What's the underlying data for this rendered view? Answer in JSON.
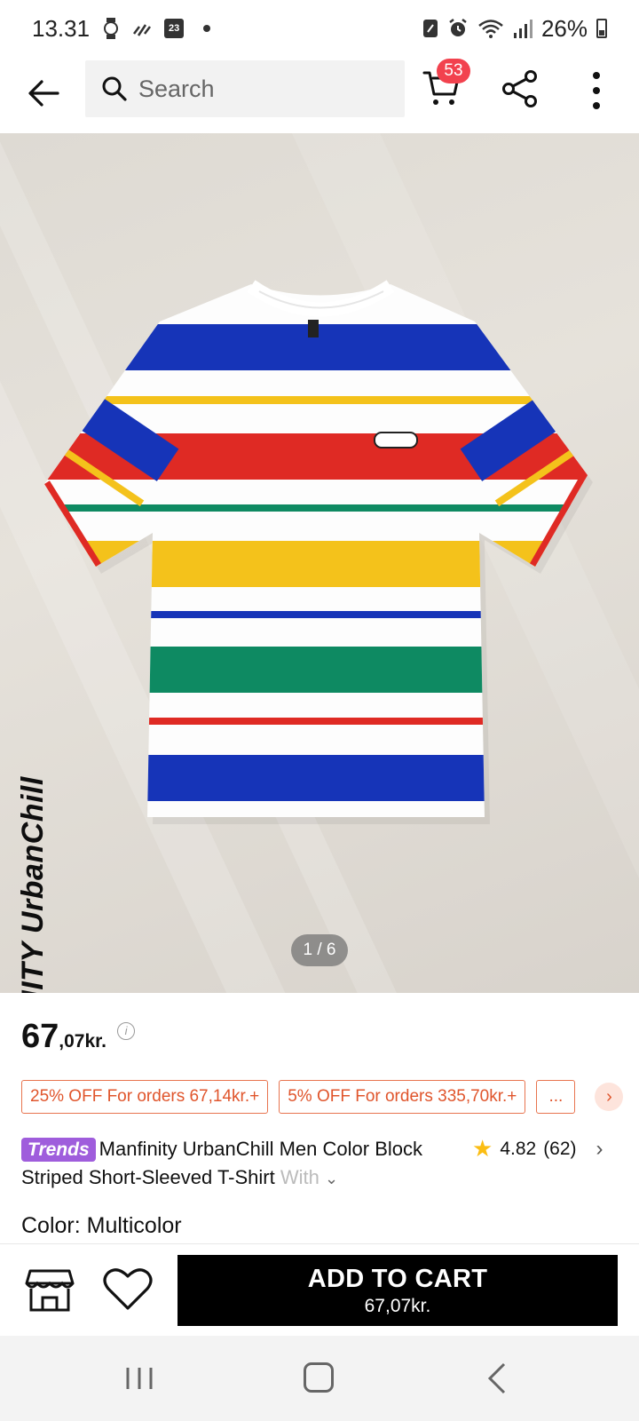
{
  "status_bar": {
    "time": "13.31",
    "calendar_day": "23",
    "battery": "26%",
    "icons": [
      "watch-icon",
      "data-saver-icon",
      "calendar-icon",
      "notification-dot",
      "nfc-icon",
      "alarm-icon",
      "wifi-icon",
      "signal-icon",
      "battery-icon"
    ]
  },
  "top_nav": {
    "search_placeholder": "Search",
    "cart_count": "53",
    "icons": [
      "back-arrow-icon",
      "search-icon",
      "cart-icon",
      "share-icon",
      "more-vertical-icon"
    ]
  },
  "hero": {
    "brand_text": "MANFINITY UrbanChill",
    "pager": "1 / 6"
  },
  "price": {
    "integer": "67",
    "decimal": ",07kr."
  },
  "coupons": [
    "25% OFF For orders 67,14kr.+",
    "5% OFF For orders 335,70kr.+",
    "..."
  ],
  "product": {
    "badge": "Trends",
    "title_main": "Manfinity UrbanChill Men Color Block Striped Short-Sleeved T-Shirt",
    "title_faded": " With"
  },
  "rating": {
    "value": "4.82",
    "count": "(62)"
  },
  "color": {
    "label": "Color: Multicolor"
  },
  "bottom_bar": {
    "add_to_cart_label": "ADD TO CART",
    "add_to_cart_price": "67,07kr."
  },
  "colors": {
    "accent_orange": "#e0552c",
    "badge_red": "#f2424e",
    "trends_purple": "#9f5ddc",
    "star_yellow": "#fbbd13",
    "stripe_blue": "#1634b8",
    "stripe_red": "#df2a24",
    "stripe_yellow": "#f4c21b",
    "stripe_green": "#0e8a62"
  }
}
